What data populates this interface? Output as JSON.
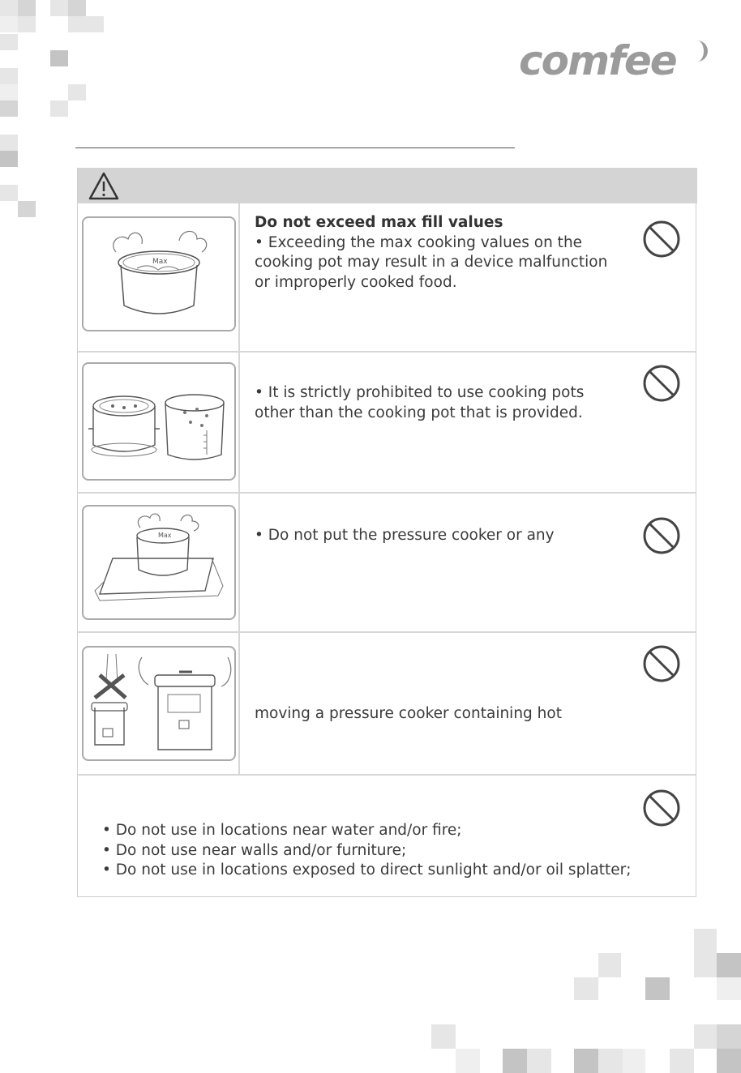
{
  "brand": {
    "logo_text": "comfee"
  },
  "colors": {
    "header_bar": "#d4d4d4",
    "text": "#3a3a3a",
    "logo": "#9b9b9b"
  },
  "warning_icon": "warning-triangle-icon",
  "prohibition_icon": "prohibition-circle-icon",
  "rows": [
    {
      "title": "Do not exceed max fill values",
      "text": "• Exceeding the max cooking values on the cooking pot may result in a device malfunction or improperly cooked food.",
      "image_label": "Max"
    },
    {
      "text": "• It is strictly prohibited to use cooking pots other than the cooking pot that is provided.",
      "image_label": ""
    },
    {
      "text": "• Do not put the pressure cooker or any",
      "image_label": "Max"
    },
    {
      "text": "moving a pressure cooker containing hot",
      "image_label": ""
    }
  ],
  "bullets": [
    "• Do not use in locations near water and/or fire;",
    "• Do not use near walls and/or furniture;",
    "• Do not use in locations exposed to direct sunlight and/or oil splatter;"
  ]
}
